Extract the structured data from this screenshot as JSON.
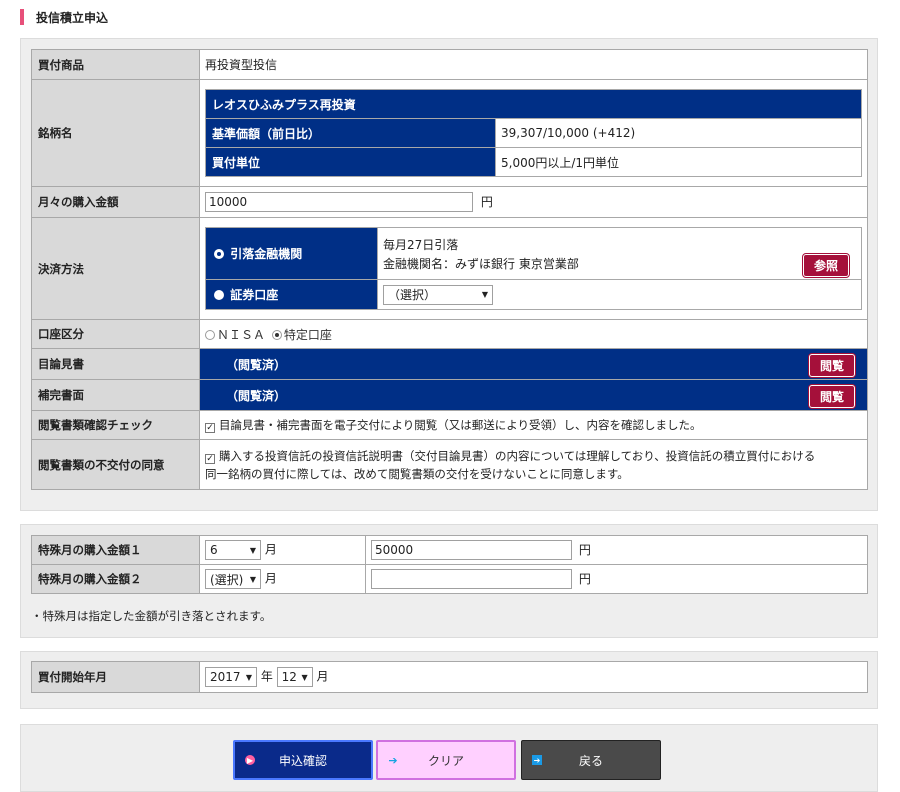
{
  "page_title": "投信積立申込",
  "main": {
    "product": {
      "label": "買付商品",
      "value": "再投資型投信"
    },
    "fund": {
      "label": "銘柄名",
      "name": "レオスひふみプラス再投資",
      "nav_label": "基準価額（前日比）",
      "nav_value": "39,307/10,000 (+412)",
      "unit_label": "買付単位",
      "unit_value": "5,000円以上/1円単位"
    },
    "monthly": {
      "label": "月々の購入金額",
      "value": "10000",
      "unit": "円"
    },
    "payment": {
      "label": "決済方法",
      "bank_label": "引落金融機関",
      "bank_line1": "毎月27日引落",
      "bank_line2": "金融機関名：みずほ銀行 東京営業部",
      "ref_button": "参照",
      "securities_label": "証券口座",
      "securities_select": "（選択）"
    },
    "account": {
      "label": "口座区分",
      "opt_nisa": "ＮＩＳＡ",
      "opt_tokutei": "特定口座"
    },
    "prospectus": {
      "label": "目論見書",
      "status": "（閲覧済）",
      "button": "閲覧"
    },
    "supplement": {
      "label": "補完書面",
      "status": "（閲覧済）",
      "button": "閲覧"
    },
    "confirm_check": {
      "label": "閲覧書類確認チェック",
      "text": "目論見書・補完書面を電子交付により閲覧（又は郵送により受領）し、内容を確認しました。"
    },
    "consent": {
      "label": "閲覧書類の不交付の同意",
      "text_line1": "購入する投資信託の投資信託説明書（交付目論見書）の内容については理解しており、投資信託の積立買付における",
      "text_line2": "同一銘柄の買付に際しては、改めて閲覧書類の交付を受けないことに同意します。"
    }
  },
  "special": {
    "row1": {
      "label": "特殊月の購入金額１",
      "month": "6",
      "month_unit": "月",
      "amount": "50000",
      "amount_unit": "円"
    },
    "row2": {
      "label": "特殊月の購入金額２",
      "month": "(選択)",
      "month_unit": "月",
      "amount": "",
      "amount_unit": "円"
    },
    "note": "・特殊月は指定した金額が引き落とされます。"
  },
  "start": {
    "label": "買付開始年月",
    "year": "2017",
    "year_unit": "年",
    "month": "12",
    "month_unit": "月"
  },
  "buttons": {
    "confirm": "申込確認",
    "clear": "クリア",
    "back": "戻る"
  }
}
